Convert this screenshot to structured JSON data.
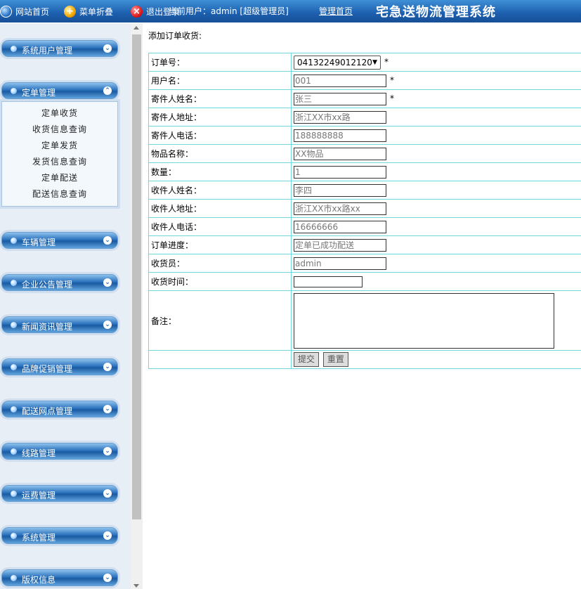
{
  "topbar": {
    "home_label": "网站首页",
    "collapse_label": "菜单折叠",
    "logout_label": "退出登录",
    "user_info": "当前用户：admin [超级管理员]",
    "admin_home": "管理首页",
    "title": "宅急送物流管理系统"
  },
  "sidebar": {
    "menus": [
      {
        "label": "系统用户管理"
      },
      {
        "label": "定单管理"
      },
      {
        "label": "车辆管理"
      },
      {
        "label": "企业公告管理"
      },
      {
        "label": "新闻资讯管理"
      },
      {
        "label": "品牌促销管理"
      },
      {
        "label": "配送网点管理"
      },
      {
        "label": "线路管理"
      },
      {
        "label": "运费管理"
      },
      {
        "label": "系统管理"
      },
      {
        "label": "版权信息"
      }
    ],
    "submenu": [
      "定单收货",
      "收货信息查询",
      "定单发货",
      "发货信息查询",
      "定单配送",
      "配送信息查询"
    ]
  },
  "form": {
    "heading": "添加订单收货:",
    "order_no_label": "订单号：",
    "order_no_value": "04132249012120",
    "user_label": "用户名：",
    "user_value": "001",
    "sender_name_label": "寄件人姓名：",
    "sender_name_value": "张三",
    "sender_addr_label": "寄件人地址：",
    "sender_addr_value": "浙江XX市xx路",
    "sender_phone_label": "寄件人电话：",
    "sender_phone_value": "188888888",
    "item_label": "物品名称：",
    "item_value": "XX物品",
    "qty_label": "数量：",
    "qty_value": "1",
    "recv_name_label": "收件人姓名：",
    "recv_name_value": "李四",
    "recv_addr_label": "收件人地址：",
    "recv_addr_value": "浙江XX市xx路xx",
    "recv_phone_label": "收件人电话：",
    "recv_phone_value": "16666666",
    "progress_label": "订单进度：",
    "progress_value": "定单已成功配送",
    "receiver_label": "收货员：",
    "receiver_value": "admin",
    "time_label": "收货时间：",
    "remark_label": "备注：",
    "required_mark": "*",
    "submit_label": "提交",
    "reset_label": "重置"
  },
  "icons": {
    "home": "globe-icon",
    "collapse": "plus-circle-icon",
    "logout": "close-circle-icon",
    "menu_dot": "dot-icon",
    "chevron": "chevron-down-icon"
  }
}
